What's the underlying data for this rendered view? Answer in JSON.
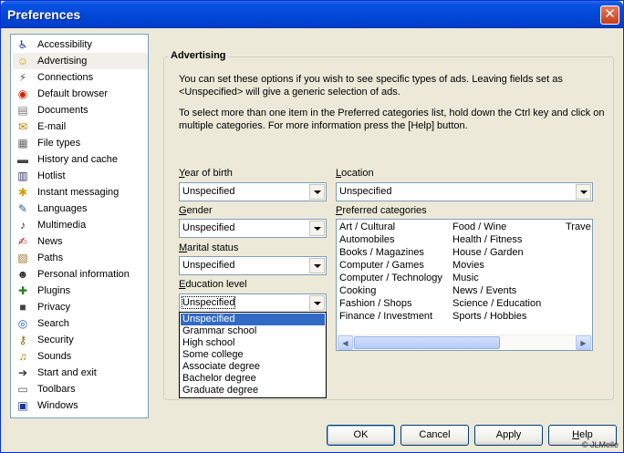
{
  "window": {
    "title": "Preferences"
  },
  "sidebar": {
    "items": [
      {
        "label": "Accessibility",
        "icon": "♿",
        "color": "#1a3a8c"
      },
      {
        "label": "Advertising",
        "icon": "☺",
        "color": "#c9a000"
      },
      {
        "label": "Connections",
        "icon": "⚡",
        "color": "#555555"
      },
      {
        "label": "Default browser",
        "icon": "◉",
        "color": "#cc2200"
      },
      {
        "label": "Documents",
        "icon": "▤",
        "color": "#777777"
      },
      {
        "label": "E-mail",
        "icon": "✉",
        "color": "#b08000"
      },
      {
        "label": "File types",
        "icon": "▦",
        "color": "#6a6a6a"
      },
      {
        "label": "History and cache",
        "icon": "▬",
        "color": "#444444"
      },
      {
        "label": "Hotlist",
        "icon": "▥",
        "color": "#333366"
      },
      {
        "label": "Instant messaging",
        "icon": "✱",
        "color": "#d4a000"
      },
      {
        "label": "Languages",
        "icon": "✎",
        "color": "#2a5a9c"
      },
      {
        "label": "Multimedia",
        "icon": "♪",
        "color": "#333333"
      },
      {
        "label": "News",
        "icon": "✍",
        "color": "#aa2222"
      },
      {
        "label": "Paths",
        "icon": "▧",
        "color": "#997733"
      },
      {
        "label": "Personal information",
        "icon": "☻",
        "color": "#333333"
      },
      {
        "label": "Plugins",
        "icon": "✚",
        "color": "#2a7a2a"
      },
      {
        "label": "Privacy",
        "icon": "■",
        "color": "#444444"
      },
      {
        "label": "Search",
        "icon": "◎",
        "color": "#1a5fbf"
      },
      {
        "label": "Security",
        "icon": "⚷",
        "color": "#8a6a00"
      },
      {
        "label": "Sounds",
        "icon": "♫",
        "color": "#b08000"
      },
      {
        "label": "Start and exit",
        "icon": "➔",
        "color": "#333333"
      },
      {
        "label": "Toolbars",
        "icon": "▭",
        "color": "#555555"
      },
      {
        "label": "Windows",
        "icon": "▣",
        "color": "#1a3a8c"
      }
    ]
  },
  "advertising": {
    "title": "Advertising",
    "intro": "You can set these options if you wish to see specific types of ads. Leaving fields set as <Unspecified> will give a generic selection of ads.",
    "help_text": "To select more than one item in the Preferred categories list, hold down the Ctrl key and click on multiple categories. For more information press the [Help] button.",
    "year_of_birth": {
      "label_u": "Y",
      "label_rest": "ear of birth",
      "value": "Unspecified"
    },
    "gender": {
      "label_u": "G",
      "label_rest": "ender",
      "value": "Unspecified"
    },
    "marital_status": {
      "label_u": "M",
      "label_rest": "arital status",
      "value": "Unspecified"
    },
    "education_level": {
      "label_u": "E",
      "label_rest": "ducation level",
      "value": "Unspecified",
      "options": [
        "Unspecified",
        "Grammar school",
        "High school",
        "Some college",
        "Associate degree",
        "Bachelor degree",
        "Graduate degree"
      ]
    },
    "location": {
      "label_u": "L",
      "label_rest": "ocation",
      "value": "Unspecified"
    },
    "preferred_categories": {
      "label_u": "P",
      "label_rest": "referred categories",
      "col1": [
        "Art / Cultural",
        "Automobiles",
        "Books / Magazines",
        "Computer / Games",
        "Computer / Technology",
        "Cooking",
        "Fashion / Shops",
        "Finance / Investment"
      ],
      "col2": [
        "Food / Wine",
        "Health / Fitness",
        "House / Garden",
        "Movies",
        "Music",
        "News / Events",
        "Science / Education",
        "Sports / Hobbies"
      ],
      "col3": [
        "Trave"
      ]
    }
  },
  "buttons": {
    "ok": "OK",
    "cancel": "Cancel",
    "apply": "Apply",
    "help": "Help"
  },
  "copyright": "© JLMelle"
}
